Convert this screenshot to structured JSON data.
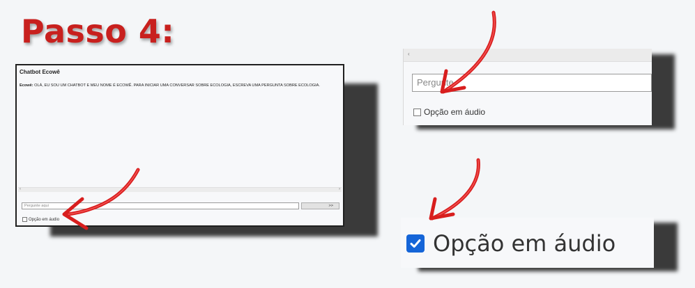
{
  "heading": "Passo 4:",
  "chat_window": {
    "title": "Chatbot Ecowê",
    "message_sender": "Ecowê:",
    "message_text": "OLÁ, EU SOU UM CHATBOT E MEU NOME É ECOWÊ. PARA INICIAR UMA CONVERSAR SOBRE ECOLOGIA, ESCREVA UMA PERGUNTA SOBRE ECOLOGIA.",
    "input_placeholder": "Pergunte aqui",
    "send_label": ">>",
    "audio_option_label": "Opção em áudio",
    "audio_option_checked": false
  },
  "zoom_input": {
    "input_visible_text": "Pergunte",
    "audio_option_label": "Opção em áudio",
    "audio_option_checked": false
  },
  "zoom_checkbox": {
    "audio_option_label": "Opção em áudio",
    "audio_option_checked": true
  },
  "colors": {
    "heading": "#c8201e",
    "arrow": "#d81e1e",
    "checkbox_checked": "#1565d8"
  },
  "icons": [
    "red-arrow-icon",
    "checkmark-icon",
    "scroll-left-icon",
    "scroll-right-icon"
  ]
}
